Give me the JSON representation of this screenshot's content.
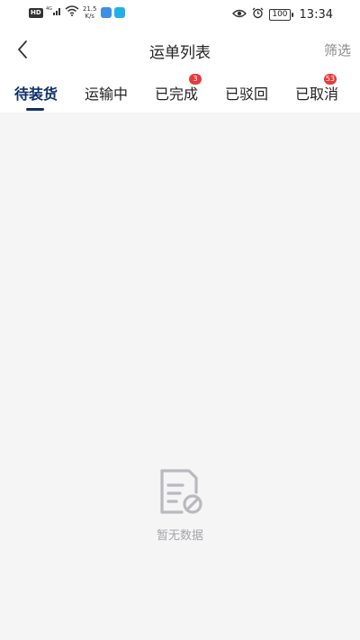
{
  "status_bar": {
    "hd": "HD",
    "signal": "4G",
    "net_speed_value": "21.5",
    "net_speed_unit": "K/s",
    "battery": "100",
    "time": "13:34"
  },
  "nav": {
    "title": "运单列表",
    "filter_label": "筛选"
  },
  "tabs": [
    {
      "label": "待装货",
      "active": true,
      "badge": ""
    },
    {
      "label": "运输中",
      "active": false,
      "badge": ""
    },
    {
      "label": "已完成",
      "active": false,
      "badge": "3"
    },
    {
      "label": "已驳回",
      "active": false,
      "badge": ""
    },
    {
      "label": "已取消",
      "active": false,
      "badge": "53"
    }
  ],
  "empty_state": {
    "text": "暂无数据",
    "icon": "no-document-icon"
  },
  "colors": {
    "accent": "#0f2f6a",
    "badge": "#e83a3a",
    "background": "#f5f5f6",
    "muted_text": "#a5a5a9"
  }
}
